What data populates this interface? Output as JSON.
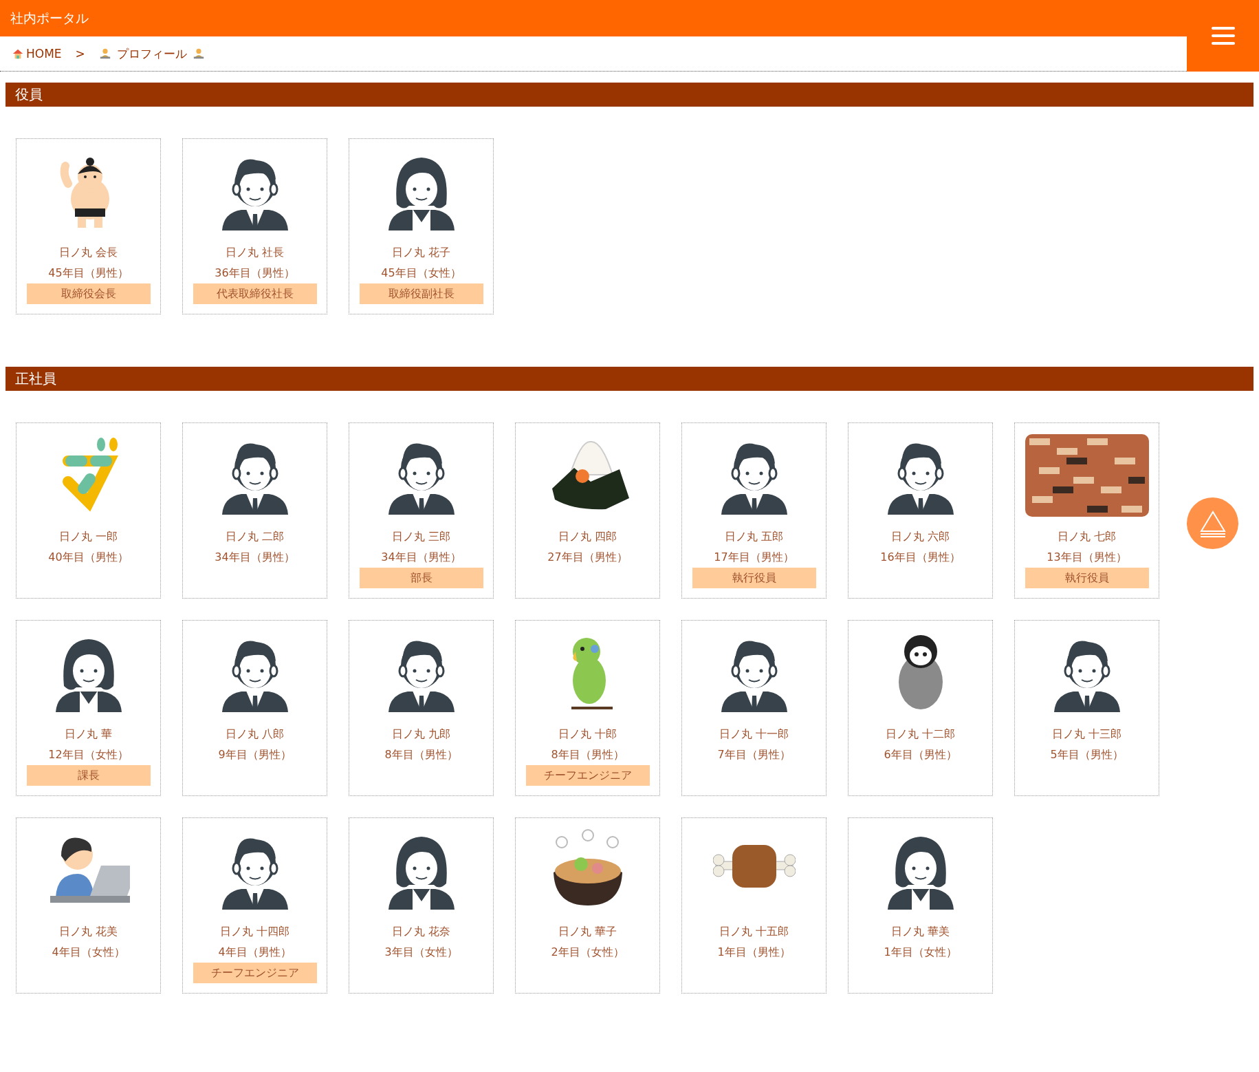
{
  "header": {
    "title": "社内ポータル"
  },
  "breadcrumb": {
    "items": [
      {
        "label": "HOME"
      },
      {
        "label": "プロフィール"
      }
    ],
    "separator": ">"
  },
  "sections": [
    {
      "title": "役員",
      "members": [
        {
          "kind": "sumo",
          "name": "日ノ丸 会長",
          "tenure": "45年目（男性）",
          "role": "取締役会長"
        },
        {
          "kind": "man",
          "name": "日ノ丸 社長",
          "tenure": "36年目（男性）",
          "role": "代表取締役社長"
        },
        {
          "kind": "woman",
          "name": "日ノ丸 花子",
          "tenure": "45年目（女性）",
          "role": "取締役副社長"
        }
      ]
    },
    {
      "title": "正社員",
      "members": [
        {
          "kind": "blob",
          "name": "日ノ丸 一郎",
          "tenure": "40年目（男性）"
        },
        {
          "kind": "man",
          "name": "日ノ丸 二郎",
          "tenure": "34年目（男性）"
        },
        {
          "kind": "man",
          "name": "日ノ丸 三郎",
          "tenure": "34年目（男性）",
          "role": "部長"
        },
        {
          "kind": "riceball",
          "name": "日ノ丸 四郎",
          "tenure": "27年目（男性）"
        },
        {
          "kind": "man",
          "name": "日ノ丸 五郎",
          "tenure": "17年目（男性）",
          "role": "執行役員"
        },
        {
          "kind": "man",
          "name": "日ノ丸 六郎",
          "tenure": "16年目（男性）"
        },
        {
          "kind": "brick",
          "name": "日ノ丸 七郎",
          "tenure": "13年目（男性）",
          "role": "執行役員"
        },
        {
          "kind": "woman",
          "name": "日ノ丸 華",
          "tenure": "12年目（女性）",
          "role": "課長"
        },
        {
          "kind": "man",
          "name": "日ノ丸 八郎",
          "tenure": "9年目（男性）"
        },
        {
          "kind": "man",
          "name": "日ノ丸 九郎",
          "tenure": "8年目（男性）"
        },
        {
          "kind": "parrot",
          "name": "日ノ丸 十郎",
          "tenure": "8年目（男性）",
          "role": "チーフエンジニア"
        },
        {
          "kind": "man",
          "name": "日ノ丸 十一郎",
          "tenure": "7年目（男性）"
        },
        {
          "kind": "penguin",
          "name": "日ノ丸 十二郎",
          "tenure": "6年目（男性）"
        },
        {
          "kind": "man",
          "name": "日ノ丸 十三郎",
          "tenure": "5年目（男性）"
        },
        {
          "kind": "laptop",
          "name": "日ノ丸 花美",
          "tenure": "4年目（女性）"
        },
        {
          "kind": "man",
          "name": "日ノ丸 十四郎",
          "tenure": "4年目（男性）",
          "role": "チーフエンジニア"
        },
        {
          "kind": "woman",
          "name": "日ノ丸 花奈",
          "tenure": "3年目（女性）"
        },
        {
          "kind": "hotpot",
          "name": "日ノ丸 華子",
          "tenure": "2年目（女性）"
        },
        {
          "kind": "meat",
          "name": "日ノ丸 十五郎",
          "tenure": "1年目（男性）"
        },
        {
          "kind": "woman",
          "name": "日ノ丸 華美",
          "tenure": "1年目（女性）"
        }
      ]
    }
  ]
}
